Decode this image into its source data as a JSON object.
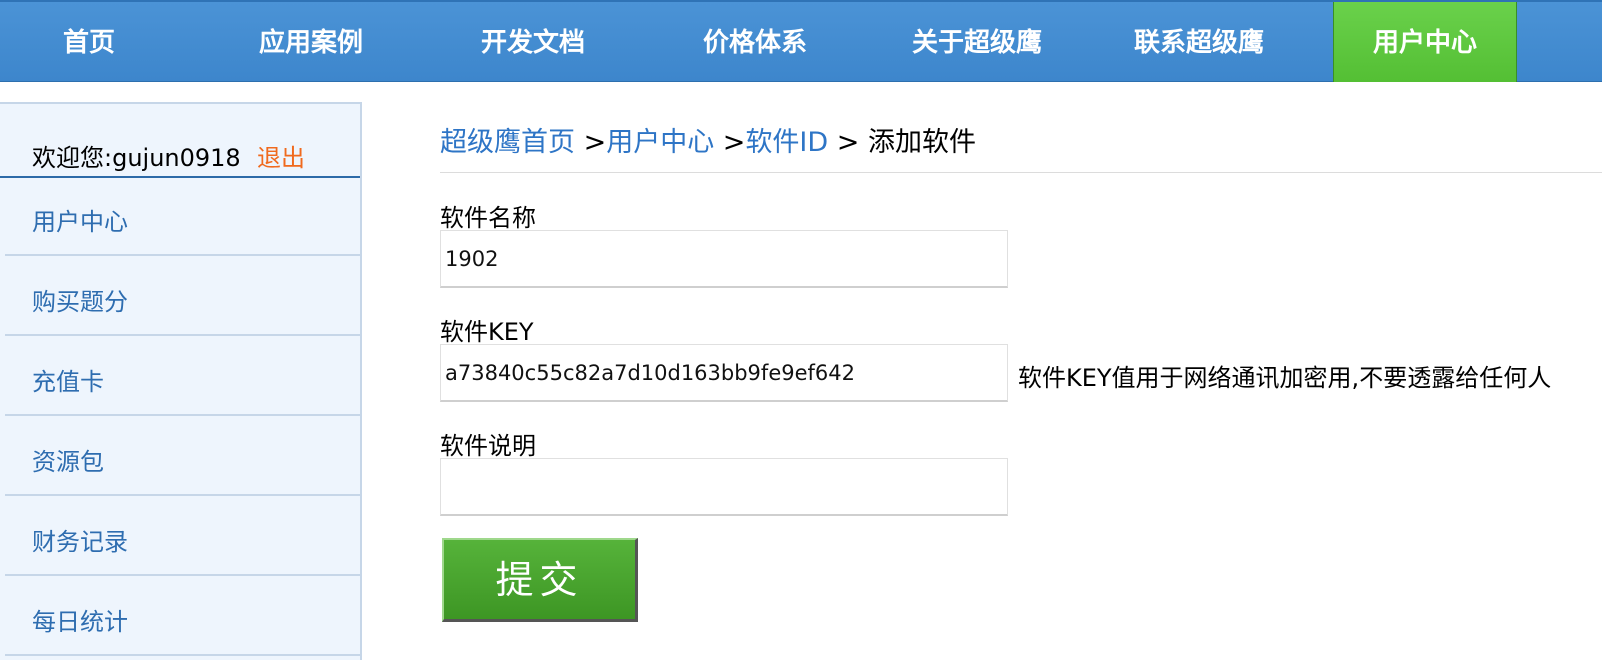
{
  "nav": {
    "items": [
      {
        "label": "首页"
      },
      {
        "label": "应用案例"
      },
      {
        "label": "开发文档"
      },
      {
        "label": "价格体系"
      },
      {
        "label": "关于超级鹰"
      },
      {
        "label": "联系超级鹰"
      },
      {
        "label": "用户中心",
        "active": true
      }
    ]
  },
  "sidebar": {
    "welcome": "欢迎您:gujun0918",
    "logout": "退出",
    "items": [
      {
        "label": "用户中心"
      },
      {
        "label": "购买题分"
      },
      {
        "label": "充值卡"
      },
      {
        "label": "资源包"
      },
      {
        "label": "财务记录"
      },
      {
        "label": "每日统计"
      }
    ]
  },
  "breadcrumb": {
    "home": "超级鹰首页",
    "sep1": " >",
    "user_center": "用户中心",
    "sep2": " >",
    "software_id": "软件ID",
    "sep3": " > ",
    "current": "添加软件"
  },
  "form": {
    "name_label": "软件名称",
    "name_value": "1902",
    "key_label": "软件KEY",
    "key_value": "a73840c55c82a7d10d163bb9fe9ef642",
    "key_hint": "软件KEY值用于网络通讯加密用,不要透露给任何人",
    "desc_label": "软件说明",
    "desc_value": "",
    "submit_label": "提交"
  },
  "colors": {
    "nav_bg": "#4b93d6",
    "nav_active": "#5cc53c",
    "link": "#2e75c6",
    "logout": "#f06a1e",
    "submit": "#4aa52f"
  }
}
